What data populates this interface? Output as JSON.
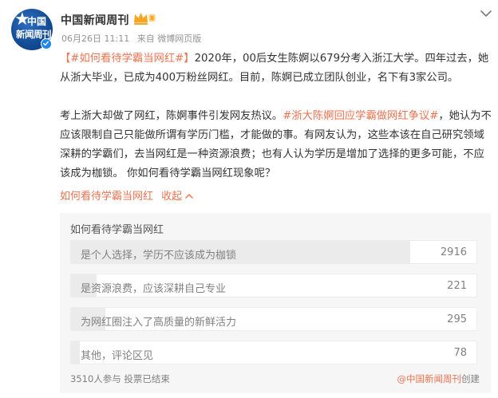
{
  "post": {
    "author": "中国新闻周刊",
    "avatar_text_line1": "中国",
    "avatar_text_line2": "新闻周刊",
    "date": "06月26日 11:11",
    "source": "来自 微博网页版",
    "p1": {
      "tag": "【#如何看待学霸当网红#】",
      "text": "2020年，00后女生陈婀以679分考入浙江大学。四年过去，她从浙大毕业，已成为400万粉丝网红。目前，陈婀已成立团队创业，名下有3家公司。"
    },
    "p2": {
      "text_a": "考上浙大却做了网红，陈婀事件引发网友热议。",
      "tag": "#浙大陈婀回应学霸做网红争议#",
      "text_b": "，她认为不应该限制自己只能做所谓有学历门槛，才能做的事。有网友认为，这些本该在自己研究领域深耕的学霸们，去当网红是一种资源浪费；也有人认为学历是增加了选择的更多可能，不应该成为枷锁。 你如何看待学霸当网红现象呢？"
    },
    "topic_link": "如何看待学霸当网红",
    "collapse_label": "收起",
    "collapse_icon": "chevron-up-icon"
  },
  "poll": {
    "title": "如何看待学霸当网红",
    "options": [
      {
        "label": "是个人选择，学历不应该成为枷锁",
        "count": "2916",
        "share": 0.836
      },
      {
        "label": "是资源浪费，应该深耕自己专业",
        "count": "221",
        "share": 0.063
      },
      {
        "label": "为网红圈注入了高质量的新鲜活力",
        "count": "295",
        "share": 0.085
      },
      {
        "label": "其他，评论区见",
        "count": "78",
        "share": 0.022
      }
    ],
    "footer": "3510人参与 投票已结束",
    "creator_handle": "@中国新闻周刊",
    "creator_suffix": "创建"
  },
  "colors": {
    "accent": "#eb7350",
    "verified": "#1f87ea",
    "crown": "#f5a623",
    "bar_fill": "#ebebeb"
  }
}
